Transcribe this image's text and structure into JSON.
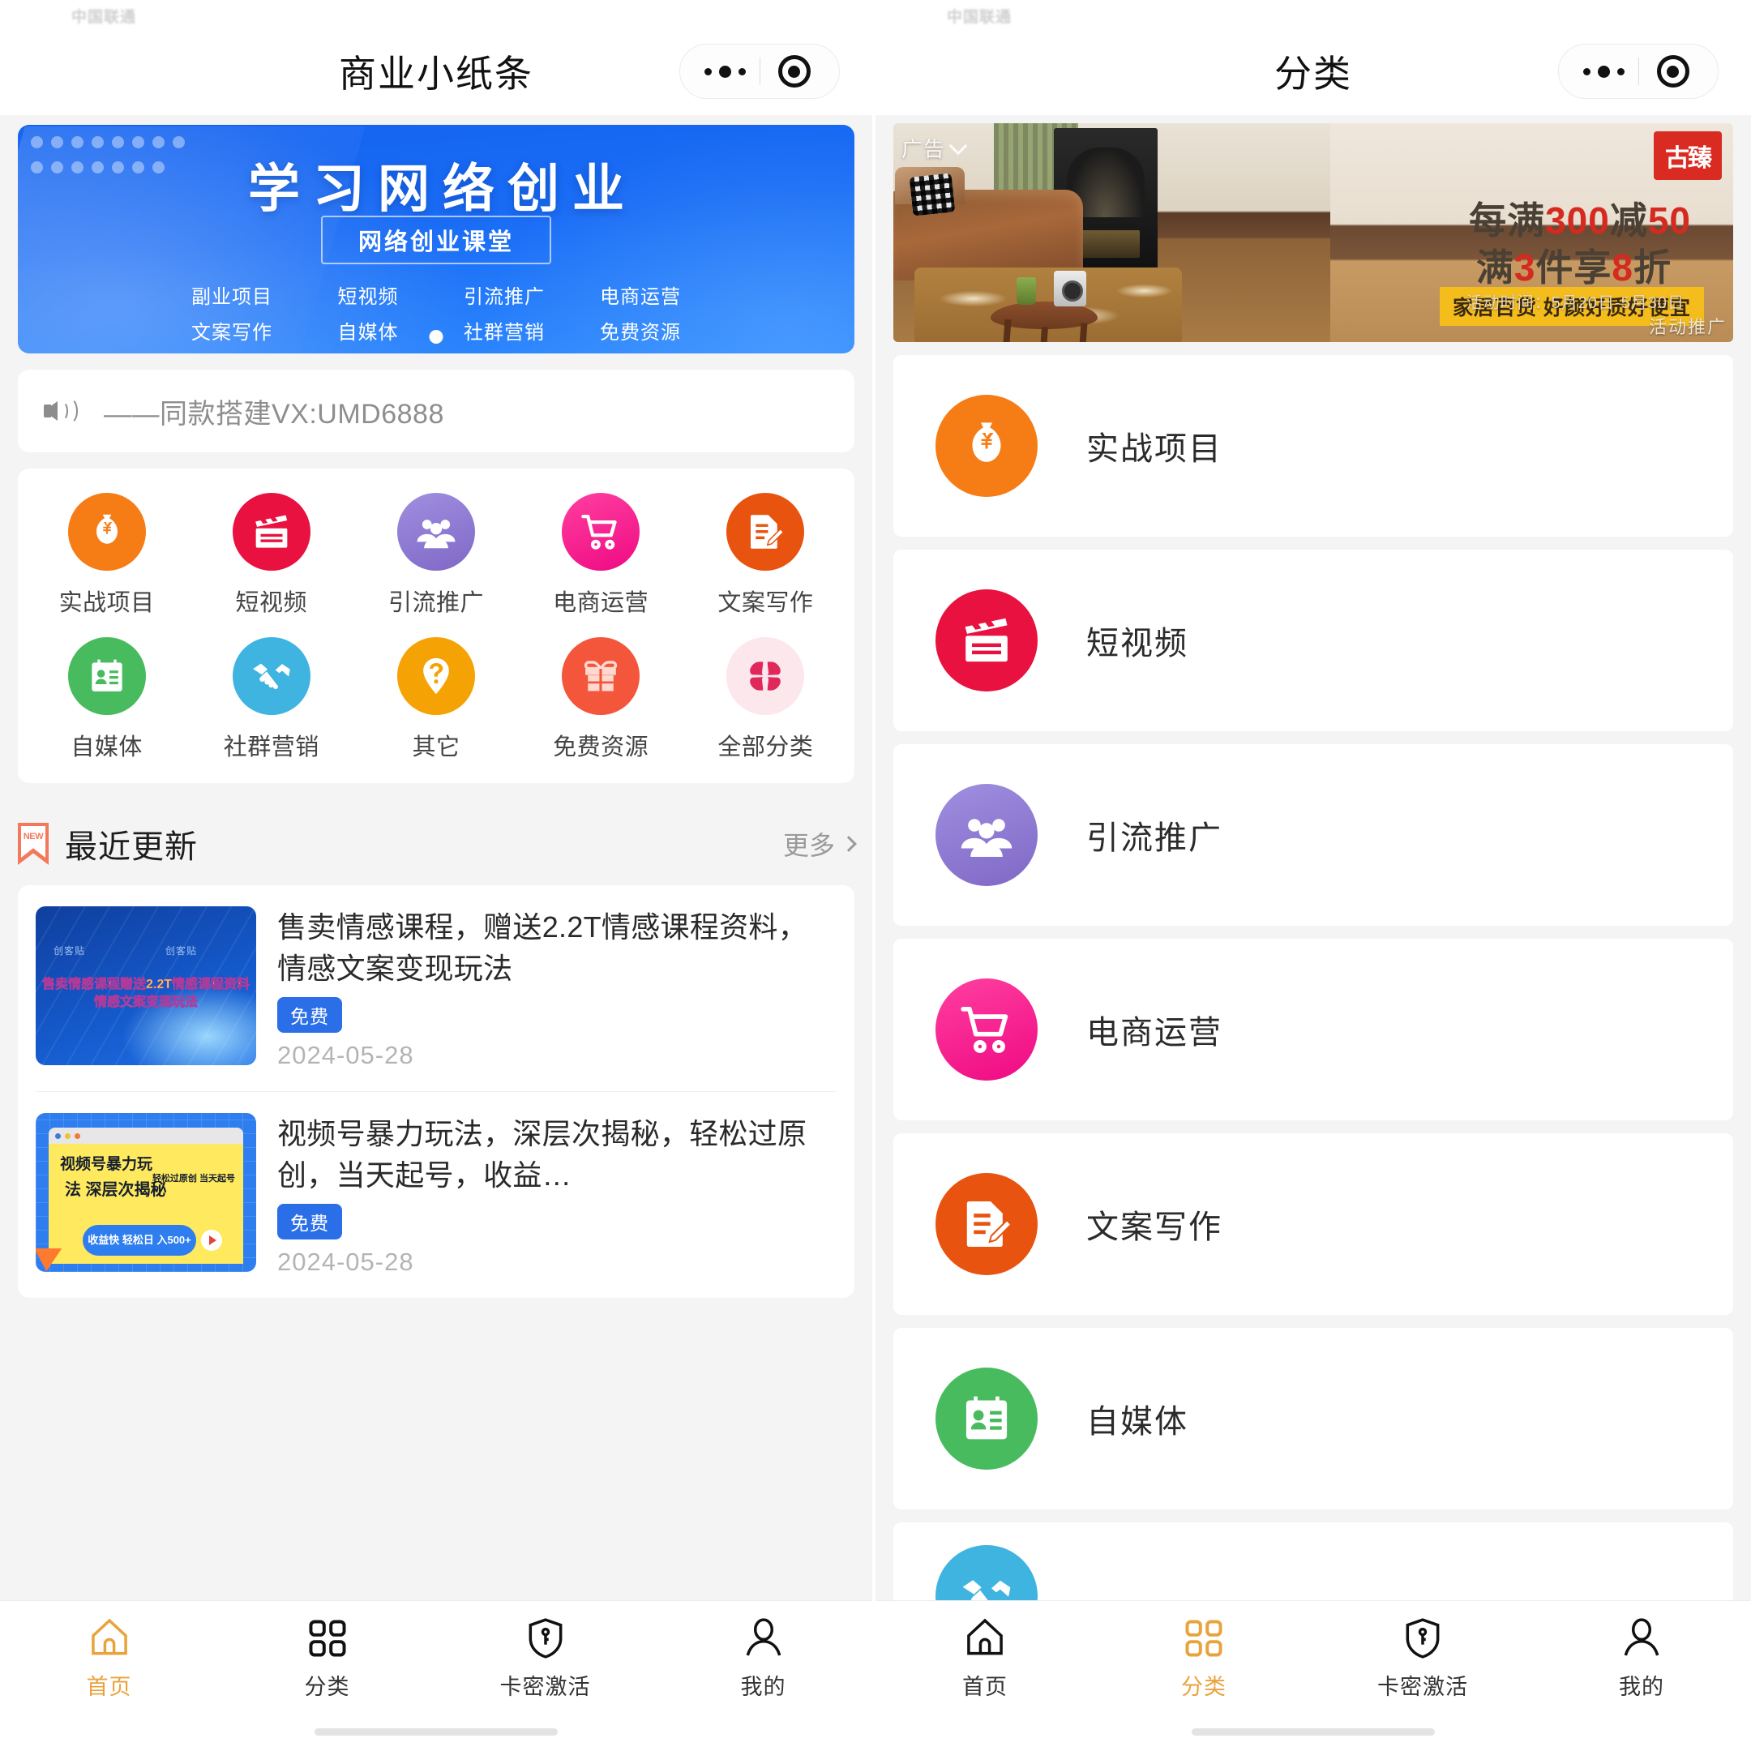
{
  "left": {
    "nav": {
      "title": "商业小纸条",
      "more_icon": "more-dots-icon",
      "target_icon": "target-circle-icon"
    },
    "hero": {
      "title": "学习网络创业",
      "subtitle": "网络创业课堂",
      "tags_row1": [
        "副业项目",
        "短视频",
        "引流推广",
        "电商运营"
      ],
      "tags_row2": [
        "文案写作",
        "自媒体",
        "社群营销",
        "免费资源"
      ],
      "indicator": "1"
    },
    "notice": {
      "icon": "speaker-icon",
      "text": "——同款搭建VX:UMD6888"
    },
    "grid": [
      {
        "label": "实战项目",
        "icon": "money-bag-icon",
        "color": "#f67c16"
      },
      {
        "label": "短视频",
        "icon": "clapperboard-icon",
        "color": "#e8113f"
      },
      {
        "label": "引流推广",
        "icon": "people-group-icon",
        "color": "#8e7ad4"
      },
      {
        "label": "电商运营",
        "icon": "shopping-cart-icon",
        "color": "#f5178e"
      },
      {
        "label": "文案写作",
        "icon": "document-pen-icon",
        "color": "#e8530f"
      },
      {
        "label": "自媒体",
        "icon": "id-card-icon",
        "color": "#48bb5e"
      },
      {
        "label": "社群营销",
        "icon": "handshake-icon",
        "color": "#3fb4e0"
      },
      {
        "label": "其它",
        "icon": "question-pin-icon",
        "color": "#f5a304"
      },
      {
        "label": "免费资源",
        "icon": "gift-icon",
        "color": "#f4563c"
      },
      {
        "label": "全部分类",
        "icon": "grid-dots-icon",
        "color": "#fbe7ec"
      }
    ],
    "section": {
      "icon": "new-ribbon-icon",
      "badge": "NEW",
      "title": "最近更新",
      "more": "更多",
      "more_icon": "chevron-right-icon"
    },
    "list": [
      {
        "title": "售卖情感课程，赠送2.2T情感课程资料，情感文案变现玩法",
        "badge": "免费",
        "date": "2024-05-28",
        "thumb_line1": "售卖情感课程赠送2.2T情感课程资料",
        "thumb_line2": "情感文案变现玩法",
        "thumb_wm_a": "创客贴",
        "thumb_wm_b": "创客贴"
      },
      {
        "title": "视频号暴力玩法，深层次揭秘，轻松过原创，当天起号，收益…",
        "badge": "免费",
        "date": "2024-05-28",
        "thumb_h1": "视频号暴力玩",
        "thumb_h2": "法 深层次揭秘",
        "thumb_h3": "轻松过原创\n当天起号",
        "thumb_pill": "收益快 轻松日\n入500+"
      }
    ],
    "tabs": [
      {
        "label": "首页",
        "icon": "home-icon",
        "active": true
      },
      {
        "label": "分类",
        "icon": "grid-squares-icon",
        "active": false
      },
      {
        "label": "卡密激活",
        "icon": "shield-key-icon",
        "active": false
      },
      {
        "label": "我的",
        "icon": "person-icon",
        "active": false
      }
    ]
  },
  "right": {
    "nav": {
      "title": "分类",
      "more_icon": "more-dots-icon",
      "target_icon": "target-circle-icon"
    },
    "ad": {
      "badge": "广告",
      "badge_icon": "chevron-down-icon",
      "logo": "古臻",
      "line1_prefix": "每满",
      "line1_num1": "300",
      "line1_mid": "减",
      "line1_num2": "50",
      "line2_prefix": "满",
      "line2_num1": "3",
      "line2_mid": "件享",
      "line2_num2": "8",
      "line2_suffix": "折",
      "strip": "家居百货 好颜好质好便宜",
      "time": "活动时间：5月20日-5月30日",
      "promo": "活动推广"
    },
    "categories": [
      {
        "label": "实战项目",
        "icon": "money-bag-icon",
        "color": "#f67c16",
        "clipped": false
      },
      {
        "label": "短视频",
        "icon": "clapperboard-icon",
        "color": "#e8113f",
        "clipped": false
      },
      {
        "label": "引流推广",
        "icon": "people-group-icon",
        "color": "#8e7ad4",
        "clipped": false
      },
      {
        "label": "电商运营",
        "icon": "shopping-cart-icon",
        "color": "#f5178e",
        "clipped": false
      },
      {
        "label": "文案写作",
        "icon": "document-pen-icon",
        "color": "#e8530f",
        "clipped": false
      },
      {
        "label": "自媒体",
        "icon": "id-card-icon",
        "color": "#48bb5e",
        "clipped": false
      },
      {
        "label": "",
        "icon": "handshake-icon",
        "color": "#3fb4e0",
        "clipped": true
      }
    ],
    "tabs": [
      {
        "label": "首页",
        "icon": "home-icon",
        "active": false
      },
      {
        "label": "分类",
        "icon": "grid-squares-icon",
        "active": true
      },
      {
        "label": "卡密激活",
        "icon": "shield-key-icon",
        "active": false
      },
      {
        "label": "我的",
        "icon": "person-icon",
        "active": false
      }
    ]
  },
  "colors": {
    "accent": "#e8a33d",
    "badge_blue": "#2b6fe8",
    "hero_blue": "#1463f0",
    "ad_red": "#d42a1f"
  }
}
